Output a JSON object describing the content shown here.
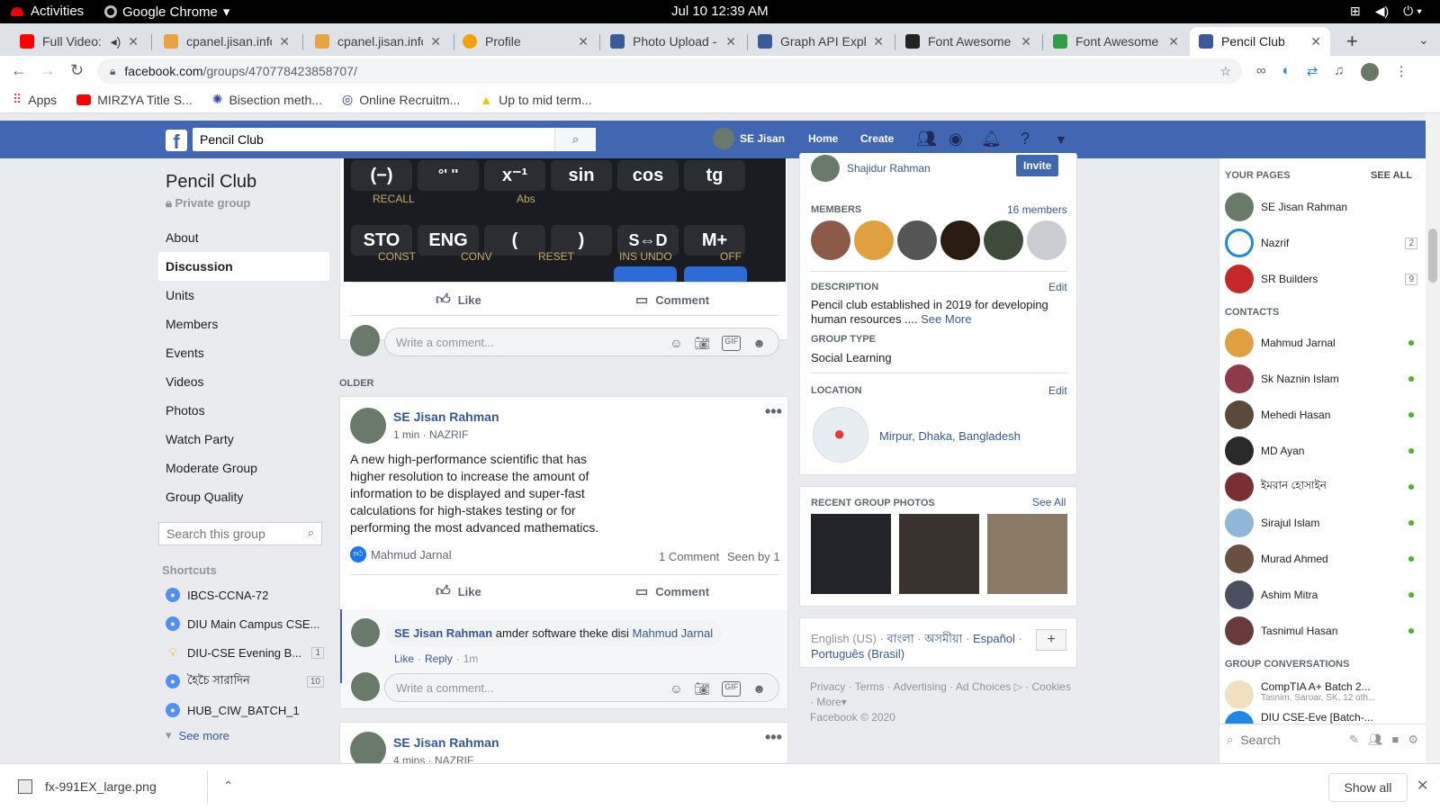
{
  "gnome": {
    "activities": "Activities",
    "app": "Google Chrome",
    "clock": "Jul 10  12:39 AM"
  },
  "tabs": [
    {
      "title": "Full Video: ",
      "color": "#ff0000"
    },
    {
      "title": "cpanel.jisan.info",
      "color": "#e8a33d"
    },
    {
      "title": "cpanel.jisan.info",
      "color": "#e8a33d"
    },
    {
      "title": "Profile",
      "color": "#f4a100"
    },
    {
      "title": "Photo Upload - ",
      "color": "#3b5998"
    },
    {
      "title": "Graph API Explo",
      "color": "#3b5998"
    },
    {
      "title": "Font Awesome",
      "color": "#222222"
    },
    {
      "title": "Font Awesome",
      "color": "#2f9e44"
    },
    {
      "title": "Pencil Club",
      "color": "#3b5998"
    }
  ],
  "browser": {
    "url_domain": "facebook.com",
    "url_path": "/groups/470778423858707/"
  },
  "bookmarks": [
    {
      "label": "Apps",
      "icon": "apps-grid-icon"
    },
    {
      "label": "MIRZYA Title S...",
      "icon": "youtube-icon"
    },
    {
      "label": "Bisection meth...",
      "icon": "atom-icon"
    },
    {
      "label": "Online Recruitm...",
      "icon": "globe-icon"
    },
    {
      "label": "Up to mid term...",
      "icon": "drive-icon"
    }
  ],
  "fb": {
    "search_value": "Pencil Club",
    "user": "SE Jisan",
    "home": "Home",
    "create": "Create"
  },
  "group": {
    "name": "Pencil Club",
    "privacy": "Private group",
    "nav": [
      "About",
      "Discussion",
      "Units",
      "Members",
      "Events",
      "Videos",
      "Photos",
      "Watch Party",
      "Moderate Group",
      "Group Quality"
    ],
    "search_placeholder": "Search this group",
    "shortcuts_title": "Shortcuts",
    "shortcuts": [
      {
        "label": "IBCS-CCNA-72",
        "count": ""
      },
      {
        "label": "DIU Main Campus CSE...",
        "count": ""
      },
      {
        "label": "DIU-CSE Evening B...",
        "count": "1"
      },
      {
        "label": "হৈচৈ সারাদিন",
        "count": "10"
      },
      {
        "label": "HUB_CIW_BATCH_1",
        "count": ""
      }
    ],
    "see_more": "See more"
  },
  "calc_keys": [
    "(−)",
    "°' ''",
    "x⁻¹",
    "sin",
    "cos",
    "tg",
    "STO",
    "ENG",
    "(",
    ")",
    "S⇔D",
    "M+"
  ],
  "calc_sublabels": [
    "RECALL",
    "Abs",
    "CONST",
    "CONV",
    "RESET",
    "INS UNDO",
    "OFF"
  ],
  "feed": {
    "like": "Like",
    "comment": "Comment",
    "write_comment": "Write a comment...",
    "older": "OLDER",
    "post1": {
      "author": "SE Jisan Rahman",
      "time": "1 min · NAZRIF",
      "text": "A new high-performance scientific that has higher resolution to increase the amount of information to be displayed and super-fast calculations for high-stakes testing or for performing the most advanced mathematics.",
      "liker": "Mahmud Jarnal",
      "comments": "1 Comment",
      "seen": "Seen by 1"
    },
    "reply": {
      "author": "SE Jisan Rahman",
      "text": "amder software theke disi",
      "mention": "Mahmud Jarnal",
      "like": "Like",
      "reply": "Reply",
      "time": "1m"
    },
    "post2": {
      "author": "SE Jisan Rahman",
      "time": "4 mins · NAZRIF"
    }
  },
  "info": {
    "invitee": "Shajidur Rahman",
    "invite": "Invite",
    "members_label": "MEMBERS",
    "members_count": "16 members",
    "member_colors": [
      "#8d5a4a",
      "#e0a040",
      "#555555",
      "#2a1a10",
      "#3e4a3a",
      "#c9ccd0"
    ],
    "description_label": "DESCRIPTION",
    "edit": "Edit",
    "description": "Pencil club established in 2019 for developing human resources ....",
    "see_more": "See More",
    "group_type_label": "GROUP TYPE",
    "group_type": "Social Learning",
    "location_label": "LOCATION",
    "location": "Mirpur, Dhaka, Bangladesh",
    "photos_label": "RECENT GROUP PHOTOS",
    "see_all": "See All",
    "languages": [
      "English (US)",
      "বাংলা",
      "অসমীয়া",
      "Español",
      "Português (Brasil)"
    ],
    "footer_links": [
      "Privacy",
      "Terms",
      "Advertising",
      "Ad Choices",
      "Cookies",
      "More"
    ],
    "copyright": "Facebook © 2020"
  },
  "chat": {
    "your_pages": "YOUR PAGES",
    "see_all": "SEE ALL",
    "pages": [
      {
        "name": "SE Jisan Rahman",
        "badge": "",
        "color": "#6a7a6a"
      },
      {
        "name": "Nazrif",
        "badge": "2",
        "color": "#1e88e5"
      },
      {
        "name": "SR Builders",
        "badge": "9",
        "color": "#c62828"
      }
    ],
    "contacts_label": "CONTACTS",
    "contacts": [
      {
        "name": "Mahmud Jarnal",
        "color": "#e0a040"
      },
      {
        "name": "Sk Naznin Islam",
        "color": "#8d3a4a"
      },
      {
        "name": "Mehedi Hasan",
        "color": "#5a4a3a"
      },
      {
        "name": "MD Ayan",
        "color": "#2a2a2a"
      },
      {
        "name": "ইমরান হোসাইন",
        "color": "#7a3030"
      },
      {
        "name": "Sirajul Islam",
        "color": "#8fb8d8"
      },
      {
        "name": "Murad Ahmed",
        "color": "#6a5040"
      },
      {
        "name": "Ashim Mitra",
        "color": "#4a5060"
      },
      {
        "name": "Tasnimul Hasan",
        "color": "#6a3a3a"
      }
    ],
    "group_conv_label": "GROUP CONVERSATIONS",
    "groups": [
      {
        "name": "CompTIA A+ Batch 2...",
        "sub": "Tasnim, Saroar, SK, 12 oth..."
      },
      {
        "name": "DIU CSE-Eve [Batch-...",
        "sub": ""
      }
    ],
    "search_placeholder": "Search"
  },
  "download": {
    "file": "fx-991EX_large.png",
    "show_all": "Show all"
  }
}
